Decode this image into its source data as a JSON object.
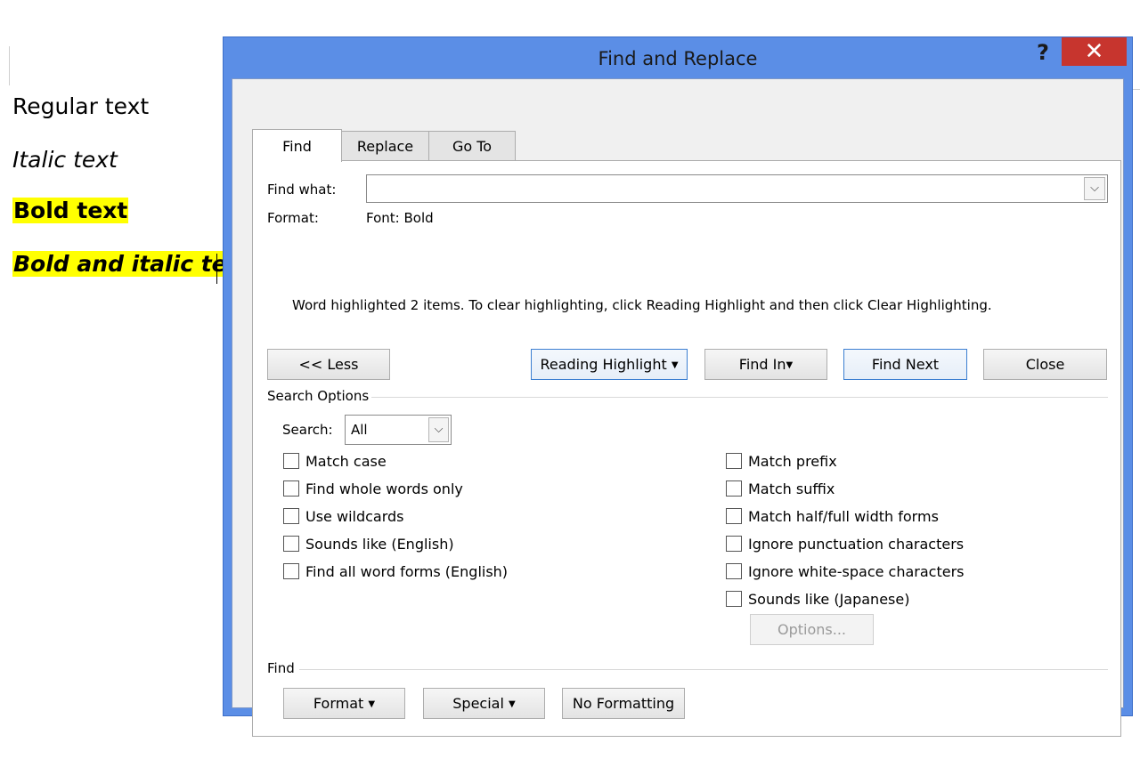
{
  "document": {
    "lines": [
      "Regular text",
      "Italic text",
      "Bold text",
      "Bold and italic text"
    ]
  },
  "dialog": {
    "title": "Find and Replace",
    "help_label": "?",
    "close_label": "✕",
    "tabs": [
      "Find",
      "Replace",
      "Go To"
    ],
    "find_what_label": "Find what:",
    "find_what_value": "",
    "format_label": "Format:",
    "format_value": "Font: Bold",
    "message": "Word highlighted 2 items. To clear highlighting, click Reading Highlight and then click Clear Highlighting.",
    "buttons": {
      "less": "<< Less",
      "reading_highlight": "Reading Highlight",
      "find_in": "Find In",
      "find_next": "Find Next",
      "close": "Close",
      "options": "Options...",
      "format": "Format",
      "special": "Special",
      "no_formatting": "No Formatting"
    },
    "search_options_label": "Search Options",
    "search_label": "Search:",
    "search_value": "All",
    "options_left": [
      "Match case",
      "Find whole words only",
      "Use wildcards",
      "Sounds like (English)",
      "Find all word forms (English)"
    ],
    "options_right": [
      "Match prefix",
      "Match suffix",
      "Match half/full width forms",
      "Ignore punctuation characters",
      "Ignore white-space characters",
      "Sounds like (Japanese)"
    ],
    "find_section_label": "Find"
  }
}
